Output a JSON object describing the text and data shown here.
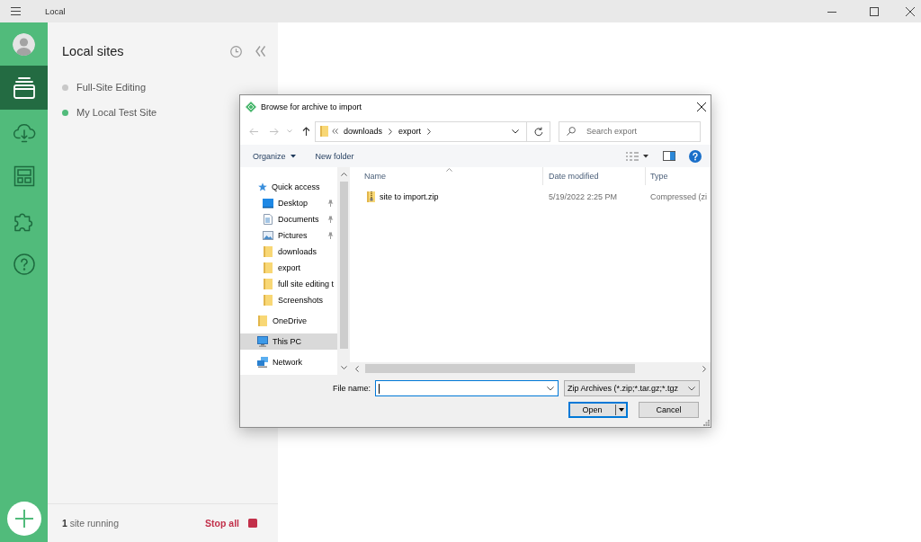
{
  "window": {
    "title": "Local"
  },
  "rail": {
    "items": [
      {
        "kind": "sites",
        "selected": true
      },
      {
        "kind": "cloud",
        "selected": false
      },
      {
        "kind": "blueprints",
        "selected": false
      },
      {
        "kind": "addons",
        "selected": false
      },
      {
        "kind": "help",
        "selected": false
      }
    ]
  },
  "sidebar": {
    "title": "Local sites",
    "sites": [
      {
        "name": "Full-Site Editing",
        "running": false
      },
      {
        "name": "My Local Test Site",
        "running": true
      }
    ],
    "status": "**1** site running",
    "stop_label": "Stop all"
  },
  "dialog": {
    "title": "Browse for archive to import",
    "nav_buttons": [
      {
        "kind": "back",
        "disabled": true
      },
      {
        "kind": "forward",
        "disabled": true
      },
      {
        "kind": "recent",
        "disabled": true
      },
      {
        "kind": "up",
        "disabled": false
      }
    ],
    "address": {
      "path": [
        "downloads",
        "export"
      ]
    },
    "search": {
      "placeholder": "Search export"
    },
    "toolbar": {
      "organize": "Organize",
      "new_folder": "New folder"
    },
    "navigation": [
      {
        "label": "Quick access",
        "kind": "star",
        "selected": false,
        "children": [
          {
            "label": "Desktop",
            "kind": "desktop",
            "pinned": true,
            "selected": false
          },
          {
            "label": "Documents",
            "kind": "documents",
            "pinned": true,
            "selected": false
          },
          {
            "label": "Pictures",
            "kind": "pictures",
            "pinned": true,
            "selected": false
          },
          {
            "label": "downloads",
            "kind": "folder",
            "pinned": false,
            "selected": false
          },
          {
            "label": "export",
            "kind": "folder",
            "pinned": false,
            "selected": false
          },
          {
            "label": "full site editing t",
            "kind": "folder",
            "pinned": false,
            "selected": false
          },
          {
            "label": "Screenshots",
            "kind": "folder",
            "pinned": false,
            "selected": false
          }
        ]
      },
      {
        "label": "OneDrive",
        "kind": "folder",
        "selected": false
      },
      {
        "label": "This PC",
        "kind": "pc",
        "selected": true
      },
      {
        "label": "Network",
        "kind": "network",
        "selected": false
      }
    ],
    "columns": [
      {
        "label": "Name",
        "sorted": true
      },
      {
        "label": "Date modified",
        "sorted": false
      },
      {
        "label": "Type",
        "sorted": false
      }
    ],
    "files": [
      {
        "name": "site to import.zip",
        "date_modified": "5/19/2022 2:25 PM",
        "type": "Compressed (zi"
      }
    ],
    "file_name": {
      "label": "File name:"
    },
    "file_type": "Zip Archives (*.zip;*.tar.gz;*.tgz",
    "buttons": [
      {
        "label": "Open",
        "kind": "split",
        "default": true
      },
      {
        "label": "Cancel",
        "kind": "plain",
        "default": false
      }
    ]
  }
}
